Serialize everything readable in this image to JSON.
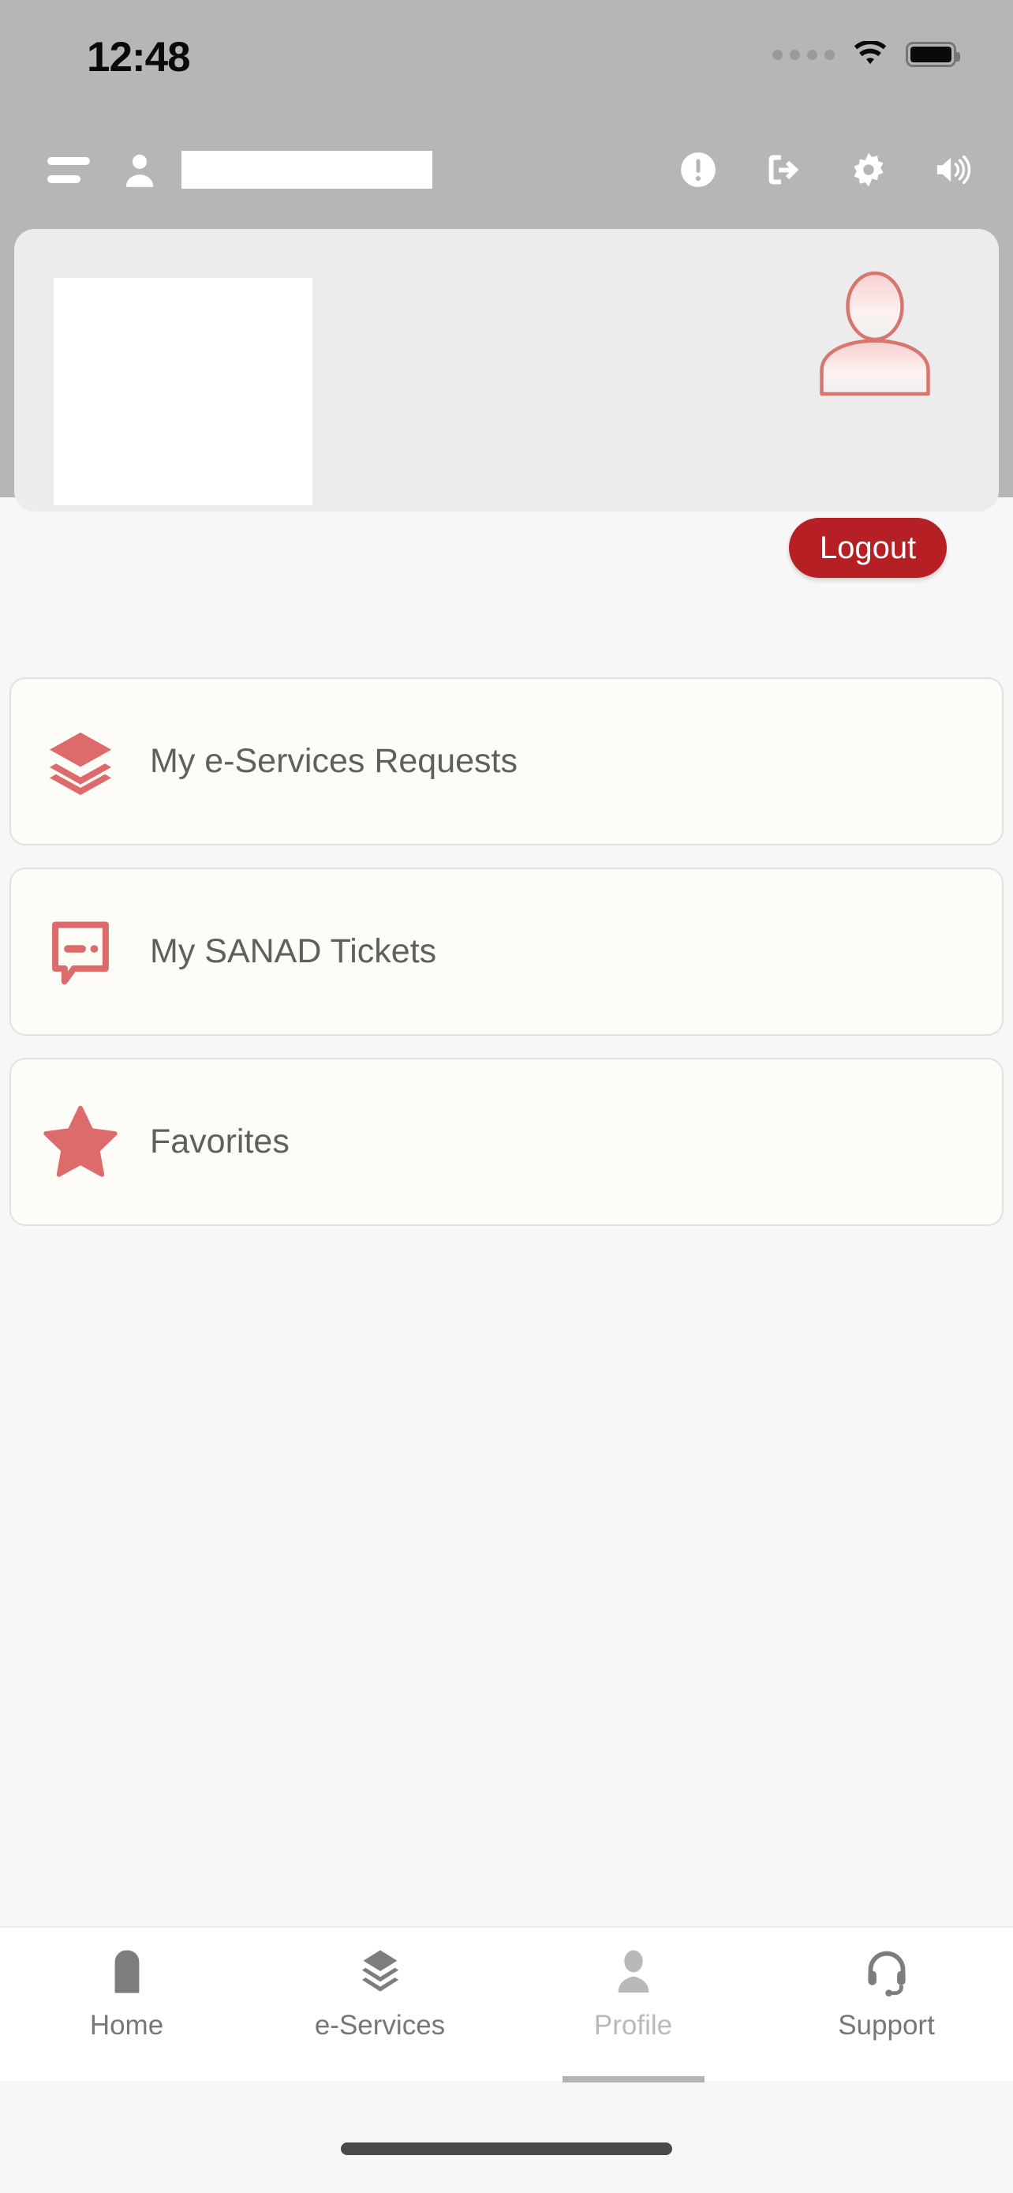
{
  "status_bar": {
    "time": "12:48",
    "icons": [
      "signal-dots-icon",
      "wifi-icon",
      "battery-icon"
    ]
  },
  "header": {
    "menu_icon": "hamburger-menu-icon",
    "user_icon": "person-icon",
    "blank_field_value": "",
    "actions": [
      {
        "name": "info-icon",
        "label": "Info"
      },
      {
        "name": "logout-arrow-icon",
        "label": "Sign out"
      },
      {
        "name": "gear-icon",
        "label": "Settings"
      },
      {
        "name": "speaker-icon",
        "label": "Sound"
      }
    ]
  },
  "profile_card": {
    "avatar_icon": "avatar-person-icon",
    "details_value": "",
    "logout_label": "Logout"
  },
  "menu": {
    "items": [
      {
        "icon": "layers-stack-icon",
        "label": "My e-Services Requests"
      },
      {
        "icon": "chat-bubble-icon",
        "label": "My SANAD Tickets"
      },
      {
        "icon": "star-icon",
        "label": "Favorites"
      }
    ]
  },
  "tabbar": {
    "items": [
      {
        "icon": "home-icon",
        "label": "Home",
        "active": false
      },
      {
        "icon": "layers-icon",
        "label": "e-Services",
        "active": false
      },
      {
        "icon": "person-icon",
        "label": "Profile",
        "active": true
      },
      {
        "icon": "headset-icon",
        "label": "Support",
        "active": false
      }
    ]
  },
  "colors": {
    "brand_red": "#b62025",
    "accent_salmon": "#dd6b6b",
    "header_gray": "#b6b6b6",
    "card_cream": "#fdfcf7",
    "page_bg": "#f7f7f7"
  }
}
